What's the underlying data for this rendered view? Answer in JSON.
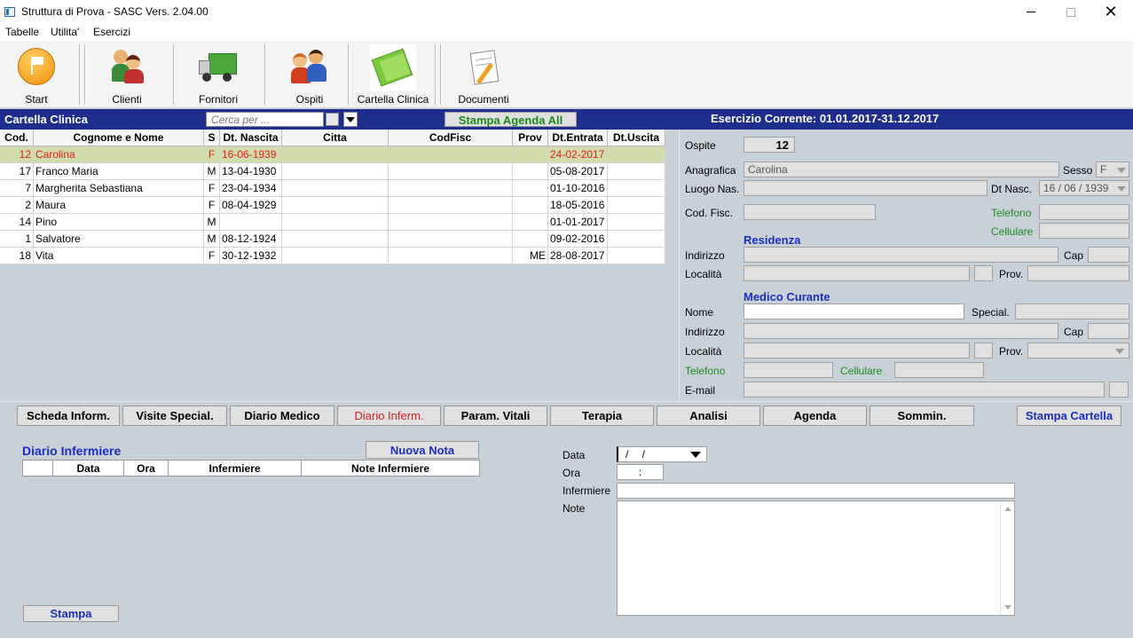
{
  "window": {
    "title": "Struttura di Prova - SASC Vers. 2.04.00"
  },
  "menu": [
    "Tabelle",
    "Utilita'",
    "Esercizi"
  ],
  "toolbar": {
    "start": "Start",
    "clienti": "Clienti",
    "fornitori": "Fornitori",
    "ospiti": "Ospiti",
    "cartella": "Cartella Clinica",
    "documenti": "Documenti"
  },
  "bluebar": {
    "title": "Cartella Clinica",
    "search_placeholder": "Cerca per ...",
    "stampa_agenda": "Stampa Agenda All",
    "esercizio": "Esercizio Corrente: 01.01.2017-31.12.2017"
  },
  "grid": {
    "headers": [
      "Cod.",
      "Cognome e Nome",
      "S",
      "Dt. Nascita",
      "Citta",
      "CodFisc",
      "Prov",
      "Dt.Entrata",
      "Dt.Uscita"
    ],
    "rows": [
      {
        "cod": "12",
        "nome": "Carolina",
        "s": "F",
        "nascita": "16-06-1939",
        "citta": "",
        "codfisc": "",
        "prov": "",
        "entrata": "24-02-2017",
        "uscita": ""
      },
      {
        "cod": "17",
        "nome": "Franco Maria",
        "s": "M",
        "nascita": "13-04-1930",
        "citta": "",
        "codfisc": "",
        "prov": "",
        "entrata": "05-08-2017",
        "uscita": ""
      },
      {
        "cod": "7",
        "nome": "Margherita Sebastiana",
        "s": "F",
        "nascita": "23-04-1934",
        "citta": "",
        "codfisc": "",
        "prov": "",
        "entrata": "01-10-2016",
        "uscita": ""
      },
      {
        "cod": "2",
        "nome": "Maura",
        "s": "F",
        "nascita": "08-04-1929",
        "citta": "",
        "codfisc": "",
        "prov": "",
        "entrata": "18-05-2016",
        "uscita": ""
      },
      {
        "cod": "14",
        "nome": "Pino",
        "s": "M",
        "nascita": "",
        "citta": "",
        "codfisc": "",
        "prov": "",
        "entrata": "01-01-2017",
        "uscita": ""
      },
      {
        "cod": "1",
        "nome": "Salvatore",
        "s": "M",
        "nascita": "08-12-1924",
        "citta": "",
        "codfisc": "",
        "prov": "",
        "entrata": "09-02-2016",
        "uscita": ""
      },
      {
        "cod": "18",
        "nome": "Vita",
        "s": "F",
        "nascita": "30-12-1932",
        "citta": "",
        "codfisc": "",
        "prov": "ME",
        "entrata": "28-08-2017",
        "uscita": ""
      }
    ]
  },
  "detail": {
    "ospite_label": "Ospite",
    "ospite_value": "12",
    "anagrafica_label": "Anagrafica",
    "anagrafica_value": "Carolina",
    "sesso_label": "Sesso",
    "sesso_value": "F",
    "luogo_label": "Luogo Nas.",
    "dtnasc_label": "Dt Nasc.",
    "dtnasc_value": "16 / 06 / 1939",
    "codfisc_label": "Cod. Fisc.",
    "telefono_label": "Telefono",
    "cellulare_label": "Cellulare",
    "residenza_header": "Residenza",
    "indirizzo_label": "Indirizzo",
    "cap_label": "Cap",
    "localita_label": "Località",
    "prov_label": "Prov.",
    "medico_header": "Medico Curante",
    "nome_label": "Nome",
    "special_label": "Special.",
    "m_indirizzo_label": "Indirizzo",
    "m_cap_label": "Cap",
    "m_localita_label": "Località",
    "m_prov_label": "Prov.",
    "m_telefono_label": "Telefono",
    "m_cellulare_label": "Cellulare",
    "email_label": "E-mail"
  },
  "tabs": [
    "Scheda Inform.",
    "Visite Special.",
    "Diario Medico",
    "Diario Inferm.",
    "Param. Vitali",
    "Terapia",
    "Analisi",
    "Agenda",
    "Sommin."
  ],
  "stampa_cartella": "Stampa Cartella",
  "diario": {
    "title": "Diario Infermiere",
    "nuova_nota": "Nuova Nota",
    "headers": [
      "",
      "Data",
      "Ora",
      "Infermiere",
      "Note Infermiere"
    ],
    "stampa": "Stampa"
  },
  "nota_form": {
    "data_label": "Data",
    "data_value": "/   /",
    "ora_label": "Ora",
    "ora_value": ":",
    "infermiere_label": "Infermiere",
    "note_label": "Note"
  },
  "colors": {
    "bluebar": "#1e2e8c",
    "accent_blue": "#1a2ec0",
    "selected_row": "#d2dcaa",
    "selected_text": "#e02020",
    "green_label": "#1f8a1f"
  }
}
